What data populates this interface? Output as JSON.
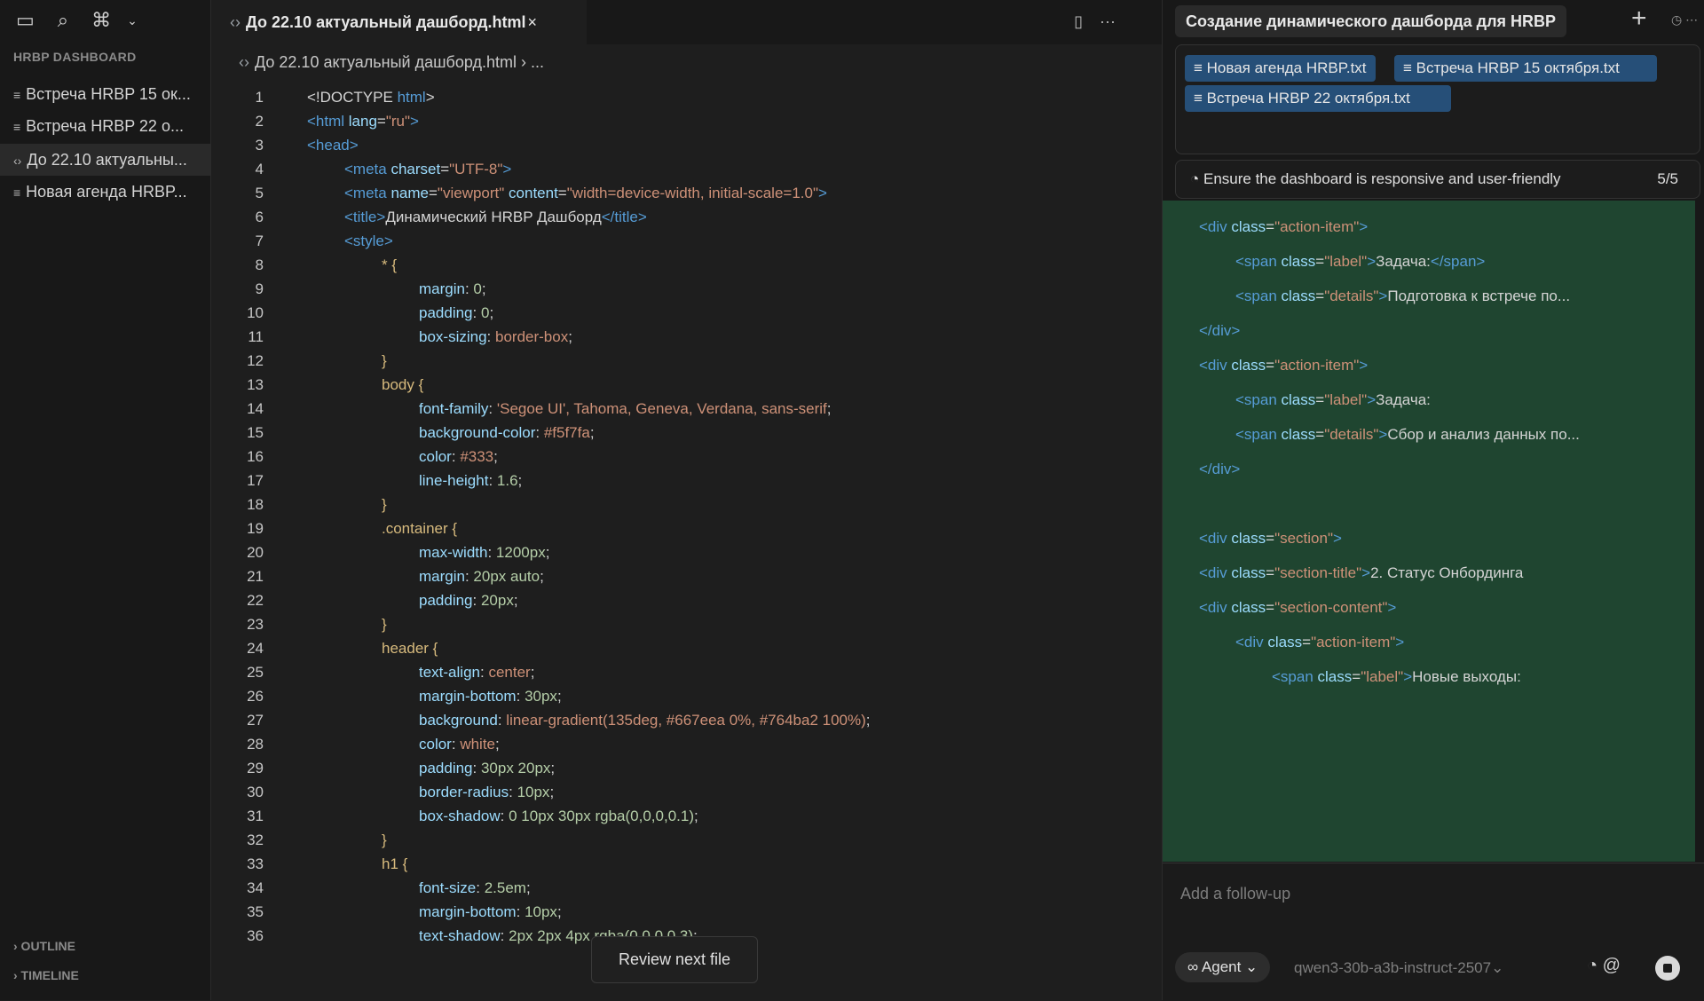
{
  "sidebar": {
    "section_title": "HRBP DASHBOARD",
    "items": [
      {
        "icon": "≡",
        "label": "Встреча HRBP 15 ок..."
      },
      {
        "icon": "≡",
        "label": "Встреча HRBP 22 о..."
      },
      {
        "icon": "‹›",
        "label": "До 22.10 актуальны..."
      },
      {
        "icon": "≡",
        "label": "Новая агенда HRBP..."
      }
    ],
    "outline": "› OUTLINE",
    "timeline": "› TIMELINE"
  },
  "editor": {
    "tab_label": "До 22.10 актуальный дашборд.html",
    "tab_close": "×",
    "breadcrumb": "До 22.10 актуальный дашборд.html › ...",
    "review_button": "Review next file",
    "lines": [
      {
        "n": "1",
        "indent": 0,
        "parts": [
          [
            "txt",
            "<!DOCTYPE "
          ],
          [
            "tag",
            "html"
          ],
          [
            "txt",
            ">"
          ]
        ]
      },
      {
        "n": "2",
        "indent": 0,
        "parts": [
          [
            "tag",
            "<html "
          ],
          [
            "at",
            "lang"
          ],
          [
            "txt",
            "="
          ],
          [
            "str",
            "\"ru\""
          ],
          [
            "tag",
            ">"
          ]
        ]
      },
      {
        "n": "3",
        "indent": 0,
        "parts": [
          [
            "tag",
            "<head>"
          ]
        ]
      },
      {
        "n": "4",
        "indent": 1,
        "parts": [
          [
            "tag",
            "<meta "
          ],
          [
            "at",
            "charset"
          ],
          [
            "txt",
            "="
          ],
          [
            "str",
            "\"UTF-8\""
          ],
          [
            "tag",
            ">"
          ]
        ]
      },
      {
        "n": "5",
        "indent": 1,
        "parts": [
          [
            "tag",
            "<meta "
          ],
          [
            "at",
            "name"
          ],
          [
            "txt",
            "="
          ],
          [
            "str",
            "\"viewport\" "
          ],
          [
            "at",
            "content"
          ],
          [
            "txt",
            "="
          ],
          [
            "str",
            "\"width=device-width, initial-scale=1.0\""
          ],
          [
            "tag",
            ">"
          ]
        ]
      },
      {
        "n": "6",
        "indent": 1,
        "parts": [
          [
            "tag",
            "<title>"
          ],
          [
            "txt",
            "Динамический HRBP Дашборд"
          ],
          [
            "tag",
            "</title>"
          ]
        ]
      },
      {
        "n": "7",
        "indent": 1,
        "parts": [
          [
            "tag",
            "<style>"
          ]
        ]
      },
      {
        "n": "8",
        "indent": 2,
        "parts": [
          [
            "sel",
            "* {"
          ]
        ]
      },
      {
        "n": "9",
        "indent": 3,
        "parts": [
          [
            "prop",
            "margin"
          ],
          [
            "txt",
            ": "
          ],
          [
            "num",
            "0"
          ],
          [
            "txt",
            ";"
          ]
        ]
      },
      {
        "n": "10",
        "indent": 3,
        "parts": [
          [
            "prop",
            "padding"
          ],
          [
            "txt",
            ": "
          ],
          [
            "num",
            "0"
          ],
          [
            "txt",
            ";"
          ]
        ]
      },
      {
        "n": "11",
        "indent": 3,
        "parts": [
          [
            "prop",
            "box-sizing"
          ],
          [
            "txt",
            ": "
          ],
          [
            "val",
            "border-box"
          ],
          [
            "txt",
            ";"
          ]
        ]
      },
      {
        "n": "12",
        "indent": 2,
        "parts": [
          [
            "sel",
            "}"
          ]
        ]
      },
      {
        "n": "13",
        "indent": 2,
        "parts": [
          [
            "sel",
            "body {"
          ]
        ]
      },
      {
        "n": "14",
        "indent": 3,
        "parts": [
          [
            "prop",
            "font-family"
          ],
          [
            "txt",
            ": "
          ],
          [
            "val",
            "'Segoe UI', Tahoma, Geneva, Verdana, sans-serif"
          ],
          [
            "txt",
            ";"
          ]
        ]
      },
      {
        "n": "15",
        "indent": 3,
        "parts": [
          [
            "prop",
            "background-color"
          ],
          [
            "txt",
            ": "
          ],
          [
            "val",
            "#f5f7fa"
          ],
          [
            "txt",
            ";"
          ]
        ]
      },
      {
        "n": "16",
        "indent": 3,
        "parts": [
          [
            "prop",
            "color"
          ],
          [
            "txt",
            ": "
          ],
          [
            "val",
            "#333"
          ],
          [
            "txt",
            ";"
          ]
        ]
      },
      {
        "n": "17",
        "indent": 3,
        "parts": [
          [
            "prop",
            "line-height"
          ],
          [
            "txt",
            ": "
          ],
          [
            "num",
            "1.6"
          ],
          [
            "txt",
            ";"
          ]
        ]
      },
      {
        "n": "18",
        "indent": 2,
        "parts": [
          [
            "sel",
            "}"
          ]
        ]
      },
      {
        "n": "19",
        "indent": 2,
        "parts": [
          [
            "sel",
            ".container {"
          ]
        ]
      },
      {
        "n": "20",
        "indent": 3,
        "parts": [
          [
            "prop",
            "max-width"
          ],
          [
            "txt",
            ": "
          ],
          [
            "num",
            "1200px"
          ],
          [
            "txt",
            ";"
          ]
        ]
      },
      {
        "n": "21",
        "indent": 3,
        "parts": [
          [
            "prop",
            "margin"
          ],
          [
            "txt",
            ": "
          ],
          [
            "num",
            "20px auto"
          ],
          [
            "txt",
            ";"
          ]
        ]
      },
      {
        "n": "22",
        "indent": 3,
        "parts": [
          [
            "prop",
            "padding"
          ],
          [
            "txt",
            ": "
          ],
          [
            "num",
            "20px"
          ],
          [
            "txt",
            ";"
          ]
        ]
      },
      {
        "n": "23",
        "indent": 2,
        "parts": [
          [
            "sel",
            "}"
          ]
        ]
      },
      {
        "n": "24",
        "indent": 2,
        "parts": [
          [
            "sel",
            "header {"
          ]
        ]
      },
      {
        "n": "25",
        "indent": 3,
        "parts": [
          [
            "prop",
            "text-align"
          ],
          [
            "txt",
            ": "
          ],
          [
            "val",
            "center"
          ],
          [
            "txt",
            ";"
          ]
        ]
      },
      {
        "n": "26",
        "indent": 3,
        "parts": [
          [
            "prop",
            "margin-bottom"
          ],
          [
            "txt",
            ": "
          ],
          [
            "num",
            "30px"
          ],
          [
            "txt",
            ";"
          ]
        ]
      },
      {
        "n": "27",
        "indent": 3,
        "parts": [
          [
            "prop",
            "background"
          ],
          [
            "txt",
            ": "
          ],
          [
            "val",
            "linear-gradient(135deg, #667eea 0%, #764ba2 100%)"
          ],
          [
            "txt",
            ";"
          ]
        ]
      },
      {
        "n": "28",
        "indent": 3,
        "parts": [
          [
            "prop",
            "color"
          ],
          [
            "txt",
            ": "
          ],
          [
            "val",
            "white"
          ],
          [
            "txt",
            ";"
          ]
        ]
      },
      {
        "n": "29",
        "indent": 3,
        "parts": [
          [
            "prop",
            "padding"
          ],
          [
            "txt",
            ": "
          ],
          [
            "num",
            "30px 20px"
          ],
          [
            "txt",
            ";"
          ]
        ]
      },
      {
        "n": "30",
        "indent": 3,
        "parts": [
          [
            "prop",
            "border-radius"
          ],
          [
            "txt",
            ": "
          ],
          [
            "num",
            "10px"
          ],
          [
            "txt",
            ";"
          ]
        ]
      },
      {
        "n": "31",
        "indent": 3,
        "parts": [
          [
            "prop",
            "box-shadow"
          ],
          [
            "txt",
            ": "
          ],
          [
            "num",
            "0 10px 30px rgba(0,0,0,0.1)"
          ],
          [
            "txt",
            ";"
          ]
        ]
      },
      {
        "n": "32",
        "indent": 2,
        "parts": [
          [
            "sel",
            "}"
          ]
        ]
      },
      {
        "n": "33",
        "indent": 2,
        "parts": [
          [
            "sel",
            "h1 {"
          ]
        ]
      },
      {
        "n": "34",
        "indent": 3,
        "parts": [
          [
            "prop",
            "font-size"
          ],
          [
            "txt",
            ": "
          ],
          [
            "num",
            "2.5em"
          ],
          [
            "txt",
            ";"
          ]
        ]
      },
      {
        "n": "35",
        "indent": 3,
        "parts": [
          [
            "prop",
            "margin-bottom"
          ],
          [
            "txt",
            ": "
          ],
          [
            "num",
            "10px"
          ],
          [
            "txt",
            ";"
          ]
        ]
      },
      {
        "n": "36",
        "indent": 3,
        "parts": [
          [
            "prop",
            "text-shadow"
          ],
          [
            "txt",
            ": "
          ],
          [
            "num",
            "2px 2px 4px rgba(0,0,0,0.3)"
          ],
          [
            "txt",
            ";"
          ]
        ]
      }
    ]
  },
  "chat": {
    "title": "Создание динамического дашборда для HRBP",
    "chips": [
      "≡ Новая агенда HRBP.txt",
      "≡ Встреча HRBP 15 октября.txt",
      "≡ Встреча HRBP 22 октября.txt"
    ],
    "todo_text": "◔ Ensure the dashboard is responsive and user-friendly",
    "todo_count": "5/5",
    "diff_lines": [
      {
        "indent": 0,
        "parts": [
          [
            "tag",
            "<div "
          ],
          [
            "at",
            "class"
          ],
          [
            "txt",
            "="
          ],
          [
            "str",
            "\"action-item\""
          ],
          [
            "tag",
            ">"
          ]
        ]
      },
      {
        "indent": 1,
        "parts": [
          [
            "tag",
            "<span "
          ],
          [
            "at",
            "class"
          ],
          [
            "txt",
            "="
          ],
          [
            "str",
            "\"label\""
          ],
          [
            "tag",
            ">"
          ],
          [
            "txt",
            "Задача:"
          ],
          [
            "tag",
            "</span>"
          ]
        ]
      },
      {
        "indent": 1,
        "parts": [
          [
            "tag",
            "<span "
          ],
          [
            "at",
            "class"
          ],
          [
            "txt",
            "="
          ],
          [
            "str",
            "\"details\""
          ],
          [
            "tag",
            ">"
          ],
          [
            "txt",
            "Подготовка к встрече по..."
          ]
        ]
      },
      {
        "indent": 0,
        "parts": [
          [
            "tag",
            "</div>"
          ]
        ]
      },
      {
        "indent": 0,
        "parts": [
          [
            "tag",
            "<div "
          ],
          [
            "at",
            "class"
          ],
          [
            "txt",
            "="
          ],
          [
            "str",
            "\"action-item\""
          ],
          [
            "tag",
            ">"
          ]
        ]
      },
      {
        "indent": 1,
        "parts": [
          [
            "tag",
            "<span "
          ],
          [
            "at",
            "class"
          ],
          [
            "txt",
            "="
          ],
          [
            "str",
            "\"label\""
          ],
          [
            "tag",
            ">"
          ],
          [
            "txt",
            "Задача:"
          ]
        ]
      },
      {
        "indent": 1,
        "parts": [
          [
            "tag",
            "<span "
          ],
          [
            "at",
            "class"
          ],
          [
            "txt",
            "="
          ],
          [
            "str",
            "\"details\""
          ],
          [
            "tag",
            ">"
          ],
          [
            "txt",
            "Сбор и анализ данных по..."
          ]
        ]
      },
      {
        "indent": 0,
        "parts": [
          [
            "tag",
            "</div>"
          ]
        ]
      },
      {
        "indent": 0,
        "parts": []
      },
      {
        "indent": 0,
        "parts": [
          [
            "tag",
            "<div "
          ],
          [
            "at",
            "class"
          ],
          [
            "txt",
            "="
          ],
          [
            "str",
            "\"section\""
          ],
          [
            "tag",
            ">"
          ]
        ]
      },
      {
        "indent": 0,
        "parts": [
          [
            "tag",
            "<div "
          ],
          [
            "at",
            "class"
          ],
          [
            "txt",
            "="
          ],
          [
            "str",
            "\"section-title\""
          ],
          [
            "tag",
            ">"
          ],
          [
            "txt",
            "2. Статус Онбординга"
          ]
        ]
      },
      {
        "indent": 0,
        "parts": [
          [
            "tag",
            "<div "
          ],
          [
            "at",
            "class"
          ],
          [
            "txt",
            "="
          ],
          [
            "str",
            "\"section-content\""
          ],
          [
            "tag",
            ">"
          ]
        ]
      },
      {
        "indent": 1,
        "parts": [
          [
            "tag",
            "<div "
          ],
          [
            "at",
            "class"
          ],
          [
            "txt",
            "="
          ],
          [
            "str",
            "\"action-item\""
          ],
          [
            "tag",
            ">"
          ]
        ]
      },
      {
        "indent": 2,
        "parts": [
          [
            "tag",
            "<span "
          ],
          [
            "at",
            "class"
          ],
          [
            "txt",
            "="
          ],
          [
            "str",
            "\"label\""
          ],
          [
            "tag",
            ">"
          ],
          [
            "txt",
            "Новые выходы:"
          ]
        ]
      }
    ],
    "input_placeholder": "Add a follow-up",
    "agent_label": "∞ Agent ⌄",
    "model_name": "qwen3-30b-a3b-instruct-2507⌄"
  }
}
